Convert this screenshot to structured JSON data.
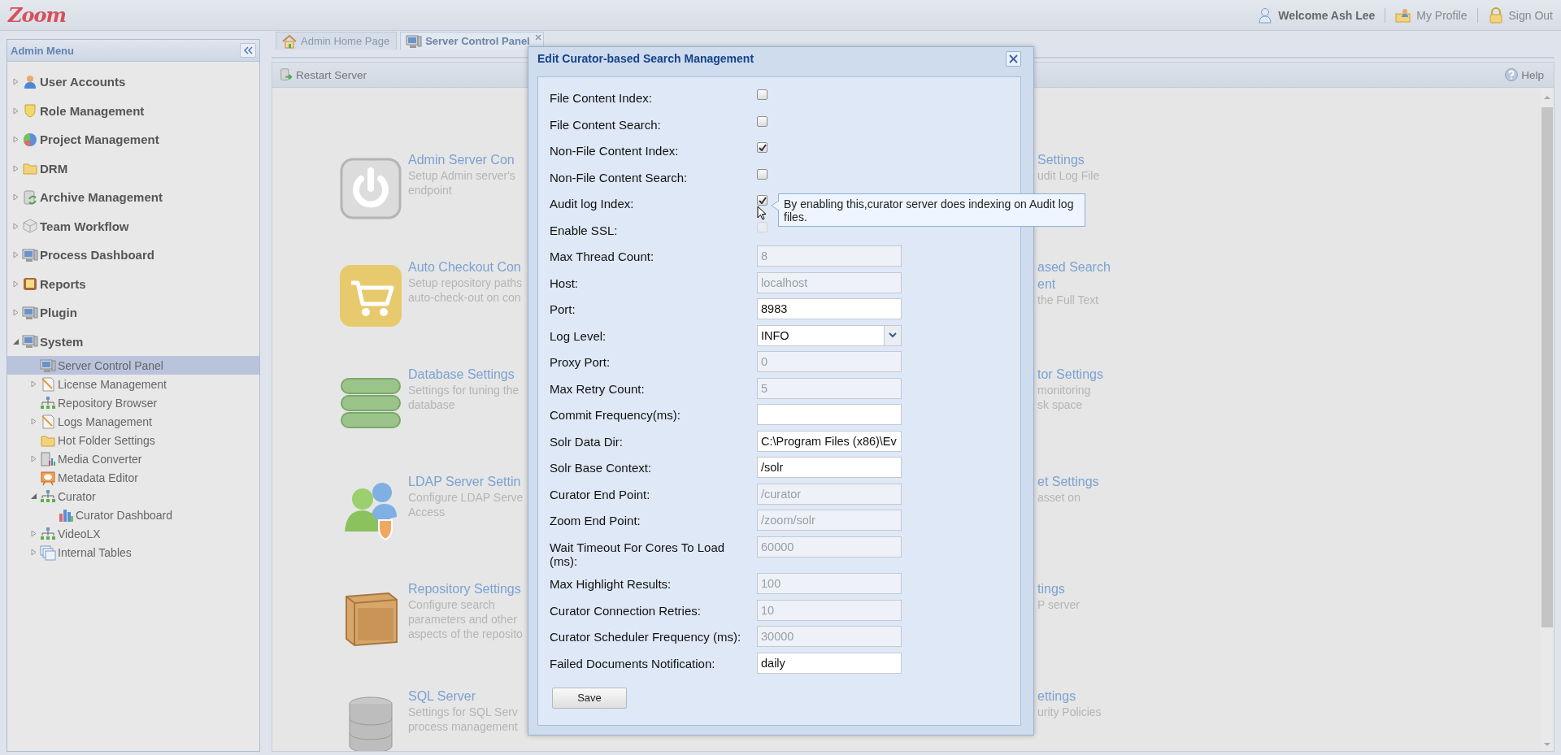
{
  "header": {
    "logo": "Zoom",
    "welcome": "Welcome Ash Lee",
    "links": [
      "My Profile",
      "Sign Out"
    ]
  },
  "sidebar": {
    "title": "Admin Menu",
    "items": [
      {
        "label": "User Accounts",
        "kind": "branch",
        "expanded": false,
        "selected": false
      },
      {
        "label": "Role Management",
        "kind": "branch",
        "expanded": false,
        "selected": false
      },
      {
        "label": "Project Management",
        "kind": "branch",
        "expanded": false,
        "selected": false
      },
      {
        "label": "DRM",
        "kind": "branch",
        "expanded": false,
        "selected": false
      },
      {
        "label": "Archive Management",
        "kind": "branch",
        "expanded": false,
        "selected": false
      },
      {
        "label": "Team Workflow",
        "kind": "branch",
        "expanded": false,
        "selected": false
      },
      {
        "label": "Process Dashboard",
        "kind": "branch",
        "expanded": false,
        "selected": false
      },
      {
        "label": "Reports",
        "kind": "branch",
        "expanded": false,
        "selected": false
      },
      {
        "label": "Plugin",
        "kind": "branch",
        "expanded": false,
        "selected": false
      },
      {
        "label": "System",
        "kind": "branch",
        "expanded": true,
        "selected": false,
        "children": [
          {
            "label": "Server Control Panel",
            "kind": "leaf",
            "selected": true
          },
          {
            "label": "License Management",
            "kind": "branch",
            "expanded": false,
            "selected": false
          },
          {
            "label": "Repository Browser",
            "kind": "leaf",
            "selected": false
          },
          {
            "label": "Logs Management",
            "kind": "branch",
            "expanded": false,
            "selected": false
          },
          {
            "label": "Hot Folder Settings",
            "kind": "leaf",
            "selected": false
          },
          {
            "label": "Media Converter",
            "kind": "branch",
            "expanded": false,
            "selected": false
          },
          {
            "label": "Metadata Editor",
            "kind": "leaf",
            "selected": false
          },
          {
            "label": "Curator",
            "kind": "branch",
            "expanded": true,
            "selected": false,
            "children": [
              {
                "label": "Curator Dashboard",
                "kind": "leaf",
                "selected": false
              }
            ]
          },
          {
            "label": "VideoLX",
            "kind": "branch",
            "expanded": false,
            "selected": false
          },
          {
            "label": "Internal Tables",
            "kind": "branch",
            "expanded": false,
            "selected": false
          }
        ]
      }
    ]
  },
  "tabs": [
    {
      "label": "Admin Home Page",
      "selected": false,
      "closable": false
    },
    {
      "label": "Server Control Panel",
      "selected": true,
      "closable": true
    }
  ],
  "toolbar": {
    "actions": [
      "Restart Server"
    ],
    "help": "Help"
  },
  "cards_left": [
    {
      "title": "Admin Server Con",
      "description_lines": [
        "Setup Admin server's",
        "endpoint"
      ]
    },
    {
      "title": "Auto Checkout Con",
      "description_lines": [
        "Setup repository paths",
        "auto-check-out on con"
      ]
    },
    {
      "title": "Database Settings",
      "description_lines": [
        "Settings for tuning the",
        "database"
      ]
    },
    {
      "title": "LDAP Server Settin",
      "description_lines": [
        "Configure LDAP Serve",
        "Access"
      ]
    },
    {
      "title": "Repository Settings",
      "description_lines": [
        "Configure search",
        "parameters and other",
        "aspects of the reposito"
      ]
    },
    {
      "title": "SQL Server",
      "description_lines": [
        "Settings for SQL Serv",
        "process management"
      ]
    }
  ],
  "cards_right": [
    {
      "title_lines": [
        "Settings"
      ],
      "description_lines": [
        "udit Log File"
      ]
    },
    {
      "title_lines": [
        "ased Search",
        "ent"
      ],
      "description_lines": [
        "the Full Text"
      ]
    },
    {
      "title_lines": [
        "tor Settings"
      ],
      "description_lines": [
        "monitoring",
        "sk space"
      ]
    },
    {
      "title_lines": [
        "et Settings"
      ],
      "description_lines": [
        "asset on"
      ]
    },
    {
      "title_lines": [
        "tings"
      ],
      "description_lines": [
        "P server"
      ]
    },
    {
      "title_lines": [
        "ettings"
      ],
      "description_lines": [
        "urity Policies"
      ]
    }
  ],
  "dialog": {
    "title": "Edit Curator-based Search Management",
    "save": "Save",
    "fields": [
      {
        "label": "File Content Index:",
        "kind": "checkbox",
        "checked": false,
        "disabled": false
      },
      {
        "label": "File Content Search:",
        "kind": "checkbox",
        "checked": false,
        "disabled": false
      },
      {
        "label": "Non-File Content Index:",
        "kind": "checkbox",
        "checked": true,
        "disabled": false
      },
      {
        "label": "Non-File Content Search:",
        "kind": "checkbox",
        "checked": false,
        "disabled": false
      },
      {
        "label": "Audit log Index:",
        "kind": "checkbox",
        "checked": true,
        "disabled": false,
        "tooltip": "By enabling this,curator server does indexing on Audit log files."
      },
      {
        "label": "Enable SSL:",
        "kind": "checkbox",
        "checked": false,
        "disabled": true
      },
      {
        "label": "Max Thread Count:",
        "kind": "text",
        "value": "8",
        "disabled": true
      },
      {
        "label": "Host:",
        "kind": "text",
        "value": "localhost",
        "disabled": true
      },
      {
        "label": "Port:",
        "kind": "text",
        "value": "8983",
        "disabled": false
      },
      {
        "label": "Log Level:",
        "kind": "select",
        "value": "INFO",
        "disabled": false
      },
      {
        "label": "Proxy Port:",
        "kind": "text",
        "value": "0",
        "disabled": true
      },
      {
        "label": "Max Retry Count:",
        "kind": "text",
        "value": "5",
        "disabled": true
      },
      {
        "label": "Commit Frequency(ms):",
        "kind": "text",
        "disabled": false
      },
      {
        "label": "Solr Data Dir:",
        "kind": "text",
        "value": "C:\\Program Files (x86)\\Ev",
        "disabled": false
      },
      {
        "label": "Solr Base Context:",
        "kind": "text",
        "value": "/solr",
        "disabled": false
      },
      {
        "label": "Curator End Point:",
        "kind": "text",
        "value": "/curator",
        "disabled": true
      },
      {
        "label": "Zoom End Point:",
        "kind": "text",
        "value": "/zoom/solr",
        "disabled": true
      },
      {
        "label": "Wait Timeout For Cores To Load (ms):",
        "kind": "text",
        "value": "60000",
        "disabled": true
      },
      {
        "label": "Max Highlight Results:",
        "kind": "text",
        "value": "100",
        "disabled": true
      },
      {
        "label": "Curator Connection Retries:",
        "kind": "text",
        "value": "10",
        "disabled": true
      },
      {
        "label": "Curator Scheduler Frequency (ms):",
        "kind": "text",
        "value": "30000",
        "disabled": true
      },
      {
        "label": "Failed Documents Notification:",
        "kind": "text",
        "value": "daily",
        "disabled": false
      }
    ]
  }
}
